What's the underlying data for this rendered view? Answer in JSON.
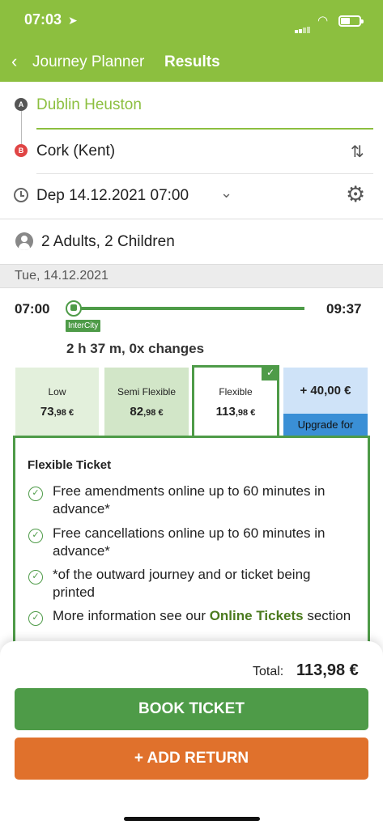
{
  "status_bar": {
    "time": "07:03"
  },
  "nav": {
    "back_label": "Journey Planner",
    "title": "Results"
  },
  "route": {
    "from": "Dublin Heuston",
    "to": "Cork (Kent)",
    "from_marker": "A",
    "to_marker": "B",
    "departure": "Dep 14.12.2021  07:00"
  },
  "passengers": "2 Adults, 2 Children",
  "date_header": "Tue, 14.12.2021",
  "journey": {
    "departure_time": "07:00",
    "arrival_time": "09:37",
    "train_type": "InterCity",
    "summary": "2 h 37 m,  0x changes"
  },
  "fares": [
    {
      "label": "Low",
      "price_main": "73",
      "price_cents": ",98 €"
    },
    {
      "label": "Semi Flexible",
      "price_main": "82",
      "price_cents": ",98 €"
    },
    {
      "label": "Flexible",
      "price_main": "113",
      "price_cents": ",98 €"
    }
  ],
  "upgrade": {
    "price": "+ 40,00 €",
    "label": "Upgrade for"
  },
  "ticket": {
    "title": "Flexible Ticket",
    "features": [
      "Free amendments online up to 60 minutes in advance*",
      "Free cancellations online up to 60 minutes in advance*",
      "*of the outward journey and or ticket being printed"
    ],
    "more_info_prefix": "More information see our ",
    "more_info_link": "Online Tickets",
    "more_info_suffix": " section"
  },
  "footer": {
    "total_label": "Total:",
    "total_value": "113,98 €",
    "book_label": "BOOK TICKET",
    "return_label": "+ ADD RETURN"
  },
  "colors": {
    "header_green": "#8cbf3f",
    "accent_green": "#4e9b48",
    "orange": "#e0712c",
    "upgrade_blue": "#3a8fd6"
  },
  "icons": [
    "location-arrow-icon",
    "wifi-icon",
    "battery-icon",
    "back-chevron-icon",
    "swap-icon",
    "clock-icon",
    "chevron-down-icon",
    "gear-icon",
    "person-icon",
    "train-icon",
    "check-icon"
  ]
}
